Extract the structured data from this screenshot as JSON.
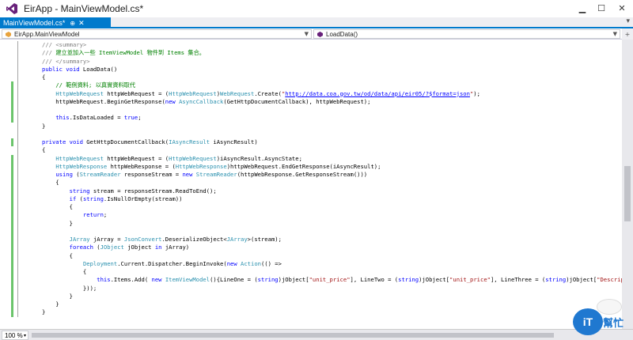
{
  "window": {
    "title": "EirApp - MainViewModel.cs*",
    "controls": {
      "minimize": "▁",
      "maximize": "☐",
      "close": "✕"
    }
  },
  "tabs": [
    {
      "label": "MainViewModel.cs*",
      "pin": "⊕",
      "close": "✕"
    }
  ],
  "tab_overflow": "▾",
  "navbar": {
    "type_dropdown": "EirApp.MainViewModel",
    "member_dropdown": "LoadData()"
  },
  "splitter": "+",
  "editor": {
    "lines": [
      [
        [
          "dc",
          "/// "
        ],
        [
          "dc",
          "<summary>"
        ]
      ],
      [
        [
          "dc",
          "/// "
        ],
        [
          "cm",
          "建立並加入一些 ItemViewModel 物件到 Items 集合。"
        ]
      ],
      [
        [
          "dc",
          "/// "
        ],
        [
          "dc",
          "</summary>"
        ]
      ],
      [
        [
          "kw",
          "public"
        ],
        [
          "p",
          " "
        ],
        [
          "kw",
          "void"
        ],
        [
          "p",
          " LoadData()"
        ]
      ],
      [
        [
          "p",
          "{"
        ]
      ],
      [
        [
          "p",
          "    "
        ],
        [
          "cm",
          "// 範例資料; 以真實資料取代"
        ]
      ],
      [
        [
          "p",
          "    "
        ],
        [
          "ty",
          "HttpWebRequest"
        ],
        [
          "p",
          " httpWebRequest = ("
        ],
        [
          "ty",
          "HttpWebRequest"
        ],
        [
          "p",
          ")"
        ],
        [
          "ty",
          "WebRequest"
        ],
        [
          "p",
          ".Create("
        ],
        [
          "st",
          "\""
        ],
        [
          "url",
          "http://data.coa.gov.tw/od/data/api/eir05/?$format=json"
        ],
        [
          "st",
          "\""
        ],
        [
          "p",
          ");"
        ]
      ],
      [
        [
          "p",
          "    httpWebRequest.BeginGetResponse("
        ],
        [
          "kw",
          "new"
        ],
        [
          "p",
          " "
        ],
        [
          "ty",
          "AsyncCallback"
        ],
        [
          "p",
          "(GetHttpDocumentCallback), httpWebRequest);"
        ]
      ],
      [
        [
          "p",
          ""
        ]
      ],
      [
        [
          "p",
          "    "
        ],
        [
          "kw",
          "this"
        ],
        [
          "p",
          ".IsDataLoaded = "
        ],
        [
          "kw",
          "true"
        ],
        [
          "p",
          ";"
        ]
      ],
      [
        [
          "p",
          "}"
        ]
      ],
      [
        [
          "p",
          ""
        ]
      ],
      [
        [
          "kw",
          "private"
        ],
        [
          "p",
          " "
        ],
        [
          "kw",
          "void"
        ],
        [
          "p",
          " GetHttpDocumentCallback("
        ],
        [
          "ty",
          "IAsyncResult"
        ],
        [
          "p",
          " iAsyncResult)"
        ]
      ],
      [
        [
          "p",
          "{"
        ]
      ],
      [
        [
          "p",
          "    "
        ],
        [
          "ty",
          "HttpWebRequest"
        ],
        [
          "p",
          " httpWebRequest = ("
        ],
        [
          "ty",
          "HttpWebRequest"
        ],
        [
          "p",
          ")iAsyncResult.AsyncState;"
        ]
      ],
      [
        [
          "p",
          "    "
        ],
        [
          "ty",
          "HttpWebResponse"
        ],
        [
          "p",
          " httpWebResponse = ("
        ],
        [
          "ty",
          "HttpWebResponse"
        ],
        [
          "p",
          ")httpWebRequest.EndGetResponse(iAsyncResult);"
        ]
      ],
      [
        [
          "p",
          "    "
        ],
        [
          "kw",
          "using"
        ],
        [
          "p",
          " ("
        ],
        [
          "ty",
          "StreamReader"
        ],
        [
          "p",
          " responseStream = "
        ],
        [
          "kw",
          "new"
        ],
        [
          "p",
          " "
        ],
        [
          "ty",
          "StreamReader"
        ],
        [
          "p",
          "(httpWebResponse.GetResponseStream()))"
        ]
      ],
      [
        [
          "p",
          "    {"
        ]
      ],
      [
        [
          "p",
          "        "
        ],
        [
          "kw",
          "string"
        ],
        [
          "p",
          " stream = responseStream.ReadToEnd();"
        ]
      ],
      [
        [
          "p",
          "        "
        ],
        [
          "kw",
          "if"
        ],
        [
          "p",
          " ("
        ],
        [
          "kw",
          "string"
        ],
        [
          "p",
          ".IsNullOrEmpty(stream))"
        ]
      ],
      [
        [
          "p",
          "        {"
        ]
      ],
      [
        [
          "p",
          "            "
        ],
        [
          "kw",
          "return"
        ],
        [
          "p",
          ";"
        ]
      ],
      [
        [
          "p",
          "        }"
        ]
      ],
      [
        [
          "p",
          ""
        ]
      ],
      [
        [
          "p",
          "        "
        ],
        [
          "ty",
          "JArray"
        ],
        [
          "p",
          " jArray = "
        ],
        [
          "ty",
          "JsonConvert"
        ],
        [
          "p",
          ".DeserializeObject<"
        ],
        [
          "ty",
          "JArray"
        ],
        [
          "p",
          ">(stream);"
        ]
      ],
      [
        [
          "p",
          "        "
        ],
        [
          "kw",
          "foreach"
        ],
        [
          "p",
          " ("
        ],
        [
          "ty",
          "JObject"
        ],
        [
          "p",
          " jObject "
        ],
        [
          "kw",
          "in"
        ],
        [
          "p",
          " jArray)"
        ]
      ],
      [
        [
          "p",
          "        {"
        ]
      ],
      [
        [
          "p",
          "            "
        ],
        [
          "ty",
          "Deployment"
        ],
        [
          "p",
          ".Current.Dispatcher.BeginInvoke("
        ],
        [
          "kw",
          "new"
        ],
        [
          "p",
          " "
        ],
        [
          "ty",
          "Action"
        ],
        [
          "p",
          "(() =>"
        ]
      ],
      [
        [
          "p",
          "            {"
        ]
      ],
      [
        [
          "p",
          "                "
        ],
        [
          "kw",
          "this"
        ],
        [
          "p",
          ".Items.Add( "
        ],
        [
          "kw",
          "new"
        ],
        [
          "p",
          " "
        ],
        [
          "ty",
          "ItemViewModel"
        ],
        [
          "p",
          "(){LineOne = ("
        ],
        [
          "kw",
          "string"
        ],
        [
          "p",
          ")jObject["
        ],
        [
          "st",
          "\"unit_price\""
        ],
        [
          "p",
          "], LineTwo = ("
        ],
        [
          "kw",
          "string"
        ],
        [
          "p",
          ")jObject["
        ],
        [
          "st",
          "\"unit_price\""
        ],
        [
          "p",
          "], LineThree = ("
        ],
        [
          "kw",
          "string"
        ],
        [
          "p",
          ")jObject["
        ],
        [
          "st",
          "\"Description\""
        ],
        [
          "p",
          "]});"
        ]
      ],
      [
        [
          "p",
          "            }));"
        ]
      ],
      [
        [
          "p",
          "        }"
        ]
      ],
      [
        [
          "p",
          "    }"
        ]
      ],
      [
        [
          "p",
          "}"
        ]
      ]
    ]
  },
  "zoom": {
    "value": "100 %",
    "arrow": "▾"
  },
  "watermark": {
    "badge": "iT",
    "text": "幫忙"
  }
}
